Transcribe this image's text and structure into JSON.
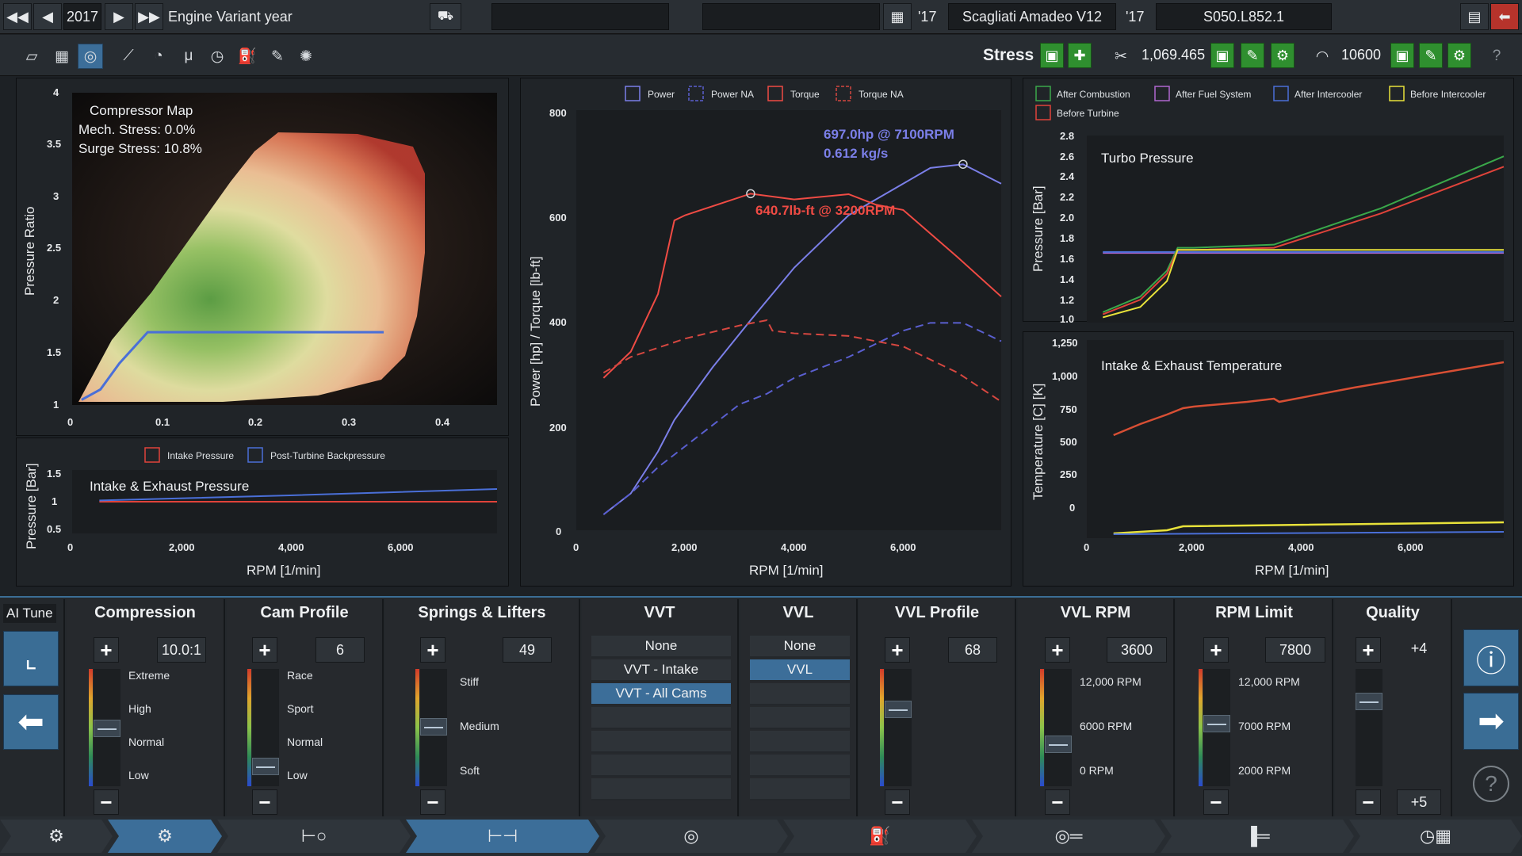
{
  "topbar": {
    "year": "2017",
    "variant_label": "Engine Variant year",
    "year_short_left": "'17",
    "engine_name": "Scagliati Amadeo V12",
    "year_short_right": "'17",
    "family_code": "S050.L852.1"
  },
  "toolbar": {
    "stress_label": "Stress",
    "cost_value": "1,069.465",
    "rpm_value": "10600"
  },
  "compressor_map": {
    "title": "Compressor Map",
    "mech_stress": "Mech. Stress: 0.0%",
    "surge_stress": "Surge Stress: 10.8%",
    "ylabel": "Pressure Ratio",
    "yticks": [
      "4",
      "3.5",
      "3",
      "2.5",
      "2",
      "1.5",
      "1"
    ],
    "xticks": [
      "0",
      "0.1",
      "0.2",
      "0.3",
      "0.4"
    ]
  },
  "intake_exhaust_pressure": {
    "legend": [
      "Intake Pressure",
      "Post-Turbine Backpressure"
    ],
    "title": "Intake & Exhaust Pressure",
    "ylabel": "Pressure [Bar]",
    "yticks": [
      "1.5",
      "1",
      "0.5"
    ],
    "xticks": [
      "0",
      "2,000",
      "4,000",
      "6,000"
    ],
    "xlabel": "RPM [1/min]"
  },
  "power_torque": {
    "legend": [
      "Power",
      "Power NA",
      "Torque",
      "Torque NA"
    ],
    "peak_power": "697.0hp @ 7100RPM",
    "peak_flow": "0.612 kg/s",
    "peak_torque": "640.7lb-ft @ 3200RPM",
    "ylabel": "Power [hp] / Torque [lb-ft]",
    "yticks": [
      "800",
      "600",
      "400",
      "200",
      "0"
    ],
    "xticks": [
      "0",
      "2,000",
      "4,000",
      "6,000"
    ],
    "xlabel": "RPM [1/min]"
  },
  "turbo_pressure": {
    "legend": [
      "After Combustion",
      "After Fuel System",
      "After Intercooler",
      "Before Intercooler",
      "Before Turbine"
    ],
    "title": "Turbo Pressure",
    "ylabel": "Pressure [Bar]",
    "yticks": [
      "2.8",
      "2.6",
      "2.4",
      "2.2",
      "2.0",
      "1.8",
      "1.6",
      "1.4",
      "1.2",
      "1.0"
    ]
  },
  "temperature": {
    "title": "Intake & Exhaust Temperature",
    "ylabel": "Temperature [C] [K]",
    "yticks": [
      "1,250",
      "1,000",
      "750",
      "500",
      "250",
      "0"
    ],
    "xticks": [
      "0",
      "2,000",
      "4,000",
      "6,000"
    ],
    "xlabel": "RPM [1/min]"
  },
  "controls": {
    "ai_tune": "AI Tune",
    "compression": {
      "title": "Compression",
      "value": "10.0:1",
      "ticks": [
        "Extreme",
        "High",
        "Normal",
        "Low"
      ]
    },
    "cam_profile": {
      "title": "Cam Profile",
      "value": "6",
      "ticks": [
        "Race",
        "Sport",
        "Normal",
        "Low"
      ]
    },
    "springs": {
      "title": "Springs & Lifters",
      "value": "49",
      "ticks": [
        "Stiff",
        "Medium",
        "Soft"
      ]
    },
    "vvt": {
      "title": "VVT",
      "options": [
        "None",
        "VVT - Intake",
        "VVT - All Cams"
      ]
    },
    "vvl": {
      "title": "VVL",
      "options": [
        "None",
        "VVL"
      ]
    },
    "vvl_profile": {
      "title": "VVL Profile",
      "value": "68"
    },
    "vvl_rpm": {
      "title": "VVL RPM",
      "value": "3600",
      "ticks": [
        "12,000 RPM",
        "6000 RPM",
        "0 RPM"
      ]
    },
    "rpm_limit": {
      "title": "RPM Limit",
      "value": "7800",
      "ticks": [
        "12,000 RPM",
        "7000 RPM",
        "2000 RPM"
      ]
    },
    "quality": {
      "title": "Quality",
      "top_value": "+4",
      "bottom_value": "+5"
    }
  },
  "chart_data": [
    {
      "type": "line",
      "title": "Compressor Map",
      "xlim": [
        0,
        0.45
      ],
      "ylim": [
        1,
        4
      ],
      "ylabel": "Pressure Ratio",
      "series": [
        {
          "x": [
            0.01,
            0.03,
            0.05,
            0.08,
            0.15,
            0.25,
            0.33
          ],
          "y": [
            1.05,
            1.15,
            1.4,
            1.7,
            1.7,
            1.7,
            1.7
          ]
        }
      ]
    },
    {
      "type": "line",
      "title": "Intake & Exhaust Pressure",
      "xlabel": "RPM [1/min]",
      "ylabel": "Pressure [Bar]",
      "xlim": [
        0,
        7800
      ],
      "ylim": [
        0.5,
        1.5
      ],
      "series": [
        {
          "name": "Intake Pressure",
          "x": [
            500,
            7800
          ],
          "y": [
            1.0,
            1.0
          ]
        },
        {
          "name": "Post-Turbine Backpressure",
          "x": [
            500,
            4000,
            7800
          ],
          "y": [
            1.02,
            1.1,
            1.2
          ]
        }
      ]
    },
    {
      "type": "line",
      "xlabel": "RPM [1/min]",
      "ylabel": "Power [hp] / Torque [lb-ft]",
      "xlim": [
        0,
        7800
      ],
      "ylim": [
        0,
        800
      ],
      "series": [
        {
          "name": "Power",
          "x": [
            500,
            1000,
            1500,
            1800,
            2500,
            3200,
            4000,
            5000,
            6000,
            6500,
            7100,
            7800
          ],
          "y": [
            30,
            70,
            150,
            210,
            310,
            400,
            500,
            600,
            660,
            690,
            697,
            660
          ]
        },
        {
          "name": "Power NA",
          "x": [
            500,
            1000,
            1500,
            2000,
            3000,
            3500,
            4000,
            5000,
            6000,
            6500,
            7100,
            7800
          ],
          "y": [
            30,
            70,
            120,
            160,
            240,
            260,
            290,
            330,
            380,
            395,
            395,
            360
          ]
        },
        {
          "name": "Torque",
          "x": [
            500,
            1000,
            1500,
            1800,
            2000,
            3200,
            4000,
            5000,
            5500,
            6000,
            7000,
            7800
          ],
          "y": [
            290,
            340,
            450,
            590,
            600,
            641,
            630,
            640,
            620,
            610,
            520,
            445
          ]
        },
        {
          "name": "Torque NA",
          "x": [
            500,
            1000,
            2000,
            3000,
            3500,
            3600,
            4000,
            5000,
            6000,
            7000,
            7800
          ],
          "y": [
            300,
            330,
            365,
            390,
            400,
            380,
            375,
            370,
            350,
            300,
            245
          ]
        }
      ]
    },
    {
      "type": "line",
      "title": "Turbo Pressure",
      "xlabel": "RPM [1/min]",
      "ylabel": "Pressure [Bar]",
      "xlim": [
        0,
        7800
      ],
      "ylim": [
        1.0,
        2.8
      ],
      "series": [
        {
          "name": "After Combustion",
          "x": [
            300,
            1000,
            1500,
            1700,
            2000,
            3500,
            5500,
            7800
          ],
          "y": [
            1.1,
            1.25,
            1.5,
            1.72,
            1.72,
            1.75,
            2.1,
            2.6
          ]
        },
        {
          "name": "Before Turbine",
          "x": [
            300,
            1000,
            1500,
            1700,
            2000,
            3500,
            5500,
            7800
          ],
          "y": [
            1.08,
            1.22,
            1.47,
            1.7,
            1.7,
            1.72,
            2.05,
            2.5
          ]
        },
        {
          "name": "Before Intercooler",
          "x": [
            300,
            1000,
            1500,
            1700,
            2000,
            7800
          ],
          "y": [
            1.05,
            1.15,
            1.4,
            1.7,
            1.7,
            1.7
          ]
        },
        {
          "name": "After Intercooler",
          "x": [
            300,
            1700,
            7800
          ],
          "y": [
            1.68,
            1.68,
            1.68
          ]
        },
        {
          "name": "After Fuel System",
          "x": [
            300,
            1700,
            7800
          ],
          "y": [
            1.67,
            1.67,
            1.67
          ]
        }
      ]
    },
    {
      "type": "line",
      "title": "Intake & Exhaust Temperature",
      "xlabel": "RPM [1/min]",
      "ylabel": "Temperature [C] [K]",
      "xlim": [
        0,
        7800
      ],
      "ylim": [
        0,
        1250
      ],
      "series": [
        {
          "x": [
            500,
            1000,
            1500,
            1800,
            2000,
            3000,
            3500,
            3600,
            5000,
            7800
          ],
          "y": [
            650,
            720,
            780,
            820,
            830,
            860,
            880,
            860,
            950,
            1110
          ]
        },
        {
          "x": [
            500,
            1500,
            1800,
            7800
          ],
          "y": [
            30,
            50,
            75,
            100
          ]
        },
        {
          "x": [
            500,
            7800
          ],
          "y": [
            25,
            40
          ]
        }
      ]
    }
  ]
}
